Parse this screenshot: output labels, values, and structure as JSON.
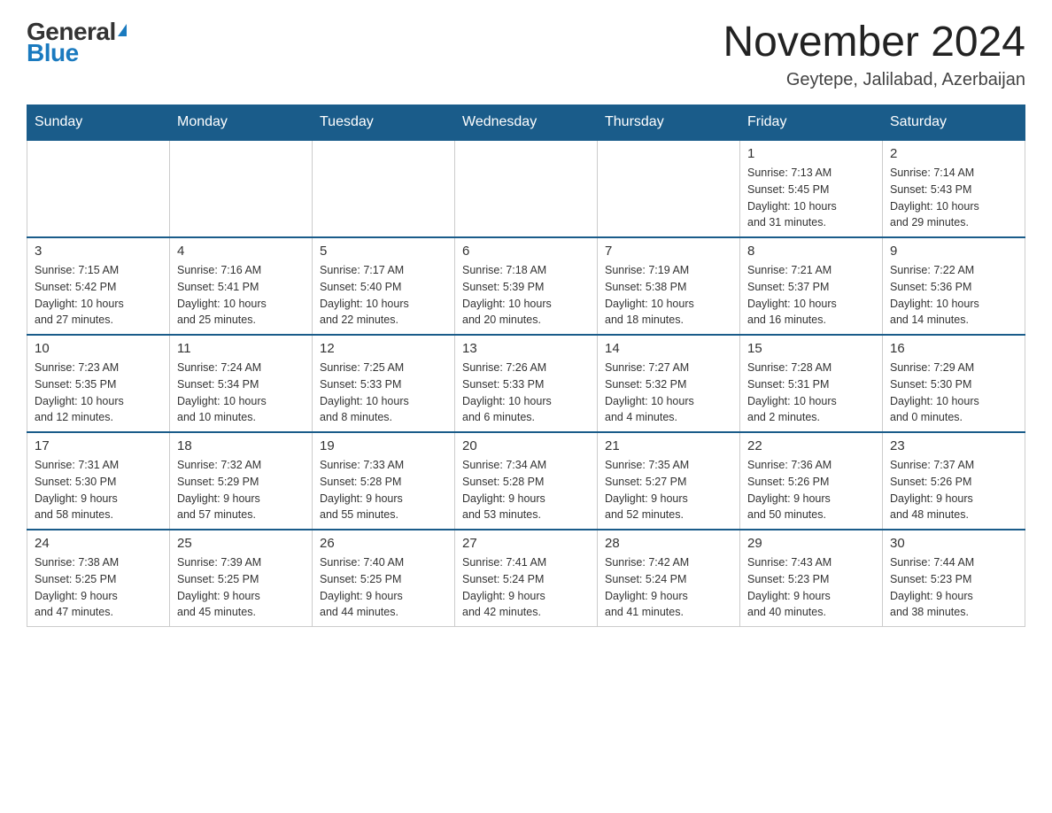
{
  "logo": {
    "general_text": "General",
    "blue_text": "Blue"
  },
  "header": {
    "title": "November 2024",
    "location": "Geytepe, Jalilabad, Azerbaijan"
  },
  "weekdays": [
    "Sunday",
    "Monday",
    "Tuesday",
    "Wednesday",
    "Thursday",
    "Friday",
    "Saturday"
  ],
  "weeks": [
    [
      {
        "day": "",
        "info": ""
      },
      {
        "day": "",
        "info": ""
      },
      {
        "day": "",
        "info": ""
      },
      {
        "day": "",
        "info": ""
      },
      {
        "day": "",
        "info": ""
      },
      {
        "day": "1",
        "info": "Sunrise: 7:13 AM\nSunset: 5:45 PM\nDaylight: 10 hours\nand 31 minutes."
      },
      {
        "day": "2",
        "info": "Sunrise: 7:14 AM\nSunset: 5:43 PM\nDaylight: 10 hours\nand 29 minutes."
      }
    ],
    [
      {
        "day": "3",
        "info": "Sunrise: 7:15 AM\nSunset: 5:42 PM\nDaylight: 10 hours\nand 27 minutes."
      },
      {
        "day": "4",
        "info": "Sunrise: 7:16 AM\nSunset: 5:41 PM\nDaylight: 10 hours\nand 25 minutes."
      },
      {
        "day": "5",
        "info": "Sunrise: 7:17 AM\nSunset: 5:40 PM\nDaylight: 10 hours\nand 22 minutes."
      },
      {
        "day": "6",
        "info": "Sunrise: 7:18 AM\nSunset: 5:39 PM\nDaylight: 10 hours\nand 20 minutes."
      },
      {
        "day": "7",
        "info": "Sunrise: 7:19 AM\nSunset: 5:38 PM\nDaylight: 10 hours\nand 18 minutes."
      },
      {
        "day": "8",
        "info": "Sunrise: 7:21 AM\nSunset: 5:37 PM\nDaylight: 10 hours\nand 16 minutes."
      },
      {
        "day": "9",
        "info": "Sunrise: 7:22 AM\nSunset: 5:36 PM\nDaylight: 10 hours\nand 14 minutes."
      }
    ],
    [
      {
        "day": "10",
        "info": "Sunrise: 7:23 AM\nSunset: 5:35 PM\nDaylight: 10 hours\nand 12 minutes."
      },
      {
        "day": "11",
        "info": "Sunrise: 7:24 AM\nSunset: 5:34 PM\nDaylight: 10 hours\nand 10 minutes."
      },
      {
        "day": "12",
        "info": "Sunrise: 7:25 AM\nSunset: 5:33 PM\nDaylight: 10 hours\nand 8 minutes."
      },
      {
        "day": "13",
        "info": "Sunrise: 7:26 AM\nSunset: 5:33 PM\nDaylight: 10 hours\nand 6 minutes."
      },
      {
        "day": "14",
        "info": "Sunrise: 7:27 AM\nSunset: 5:32 PM\nDaylight: 10 hours\nand 4 minutes."
      },
      {
        "day": "15",
        "info": "Sunrise: 7:28 AM\nSunset: 5:31 PM\nDaylight: 10 hours\nand 2 minutes."
      },
      {
        "day": "16",
        "info": "Sunrise: 7:29 AM\nSunset: 5:30 PM\nDaylight: 10 hours\nand 0 minutes."
      }
    ],
    [
      {
        "day": "17",
        "info": "Sunrise: 7:31 AM\nSunset: 5:30 PM\nDaylight: 9 hours\nand 58 minutes."
      },
      {
        "day": "18",
        "info": "Sunrise: 7:32 AM\nSunset: 5:29 PM\nDaylight: 9 hours\nand 57 minutes."
      },
      {
        "day": "19",
        "info": "Sunrise: 7:33 AM\nSunset: 5:28 PM\nDaylight: 9 hours\nand 55 minutes."
      },
      {
        "day": "20",
        "info": "Sunrise: 7:34 AM\nSunset: 5:28 PM\nDaylight: 9 hours\nand 53 minutes."
      },
      {
        "day": "21",
        "info": "Sunrise: 7:35 AM\nSunset: 5:27 PM\nDaylight: 9 hours\nand 52 minutes."
      },
      {
        "day": "22",
        "info": "Sunrise: 7:36 AM\nSunset: 5:26 PM\nDaylight: 9 hours\nand 50 minutes."
      },
      {
        "day": "23",
        "info": "Sunrise: 7:37 AM\nSunset: 5:26 PM\nDaylight: 9 hours\nand 48 minutes."
      }
    ],
    [
      {
        "day": "24",
        "info": "Sunrise: 7:38 AM\nSunset: 5:25 PM\nDaylight: 9 hours\nand 47 minutes."
      },
      {
        "day": "25",
        "info": "Sunrise: 7:39 AM\nSunset: 5:25 PM\nDaylight: 9 hours\nand 45 minutes."
      },
      {
        "day": "26",
        "info": "Sunrise: 7:40 AM\nSunset: 5:25 PM\nDaylight: 9 hours\nand 44 minutes."
      },
      {
        "day": "27",
        "info": "Sunrise: 7:41 AM\nSunset: 5:24 PM\nDaylight: 9 hours\nand 42 minutes."
      },
      {
        "day": "28",
        "info": "Sunrise: 7:42 AM\nSunset: 5:24 PM\nDaylight: 9 hours\nand 41 minutes."
      },
      {
        "day": "29",
        "info": "Sunrise: 7:43 AM\nSunset: 5:23 PM\nDaylight: 9 hours\nand 40 minutes."
      },
      {
        "day": "30",
        "info": "Sunrise: 7:44 AM\nSunset: 5:23 PM\nDaylight: 9 hours\nand 38 minutes."
      }
    ]
  ]
}
